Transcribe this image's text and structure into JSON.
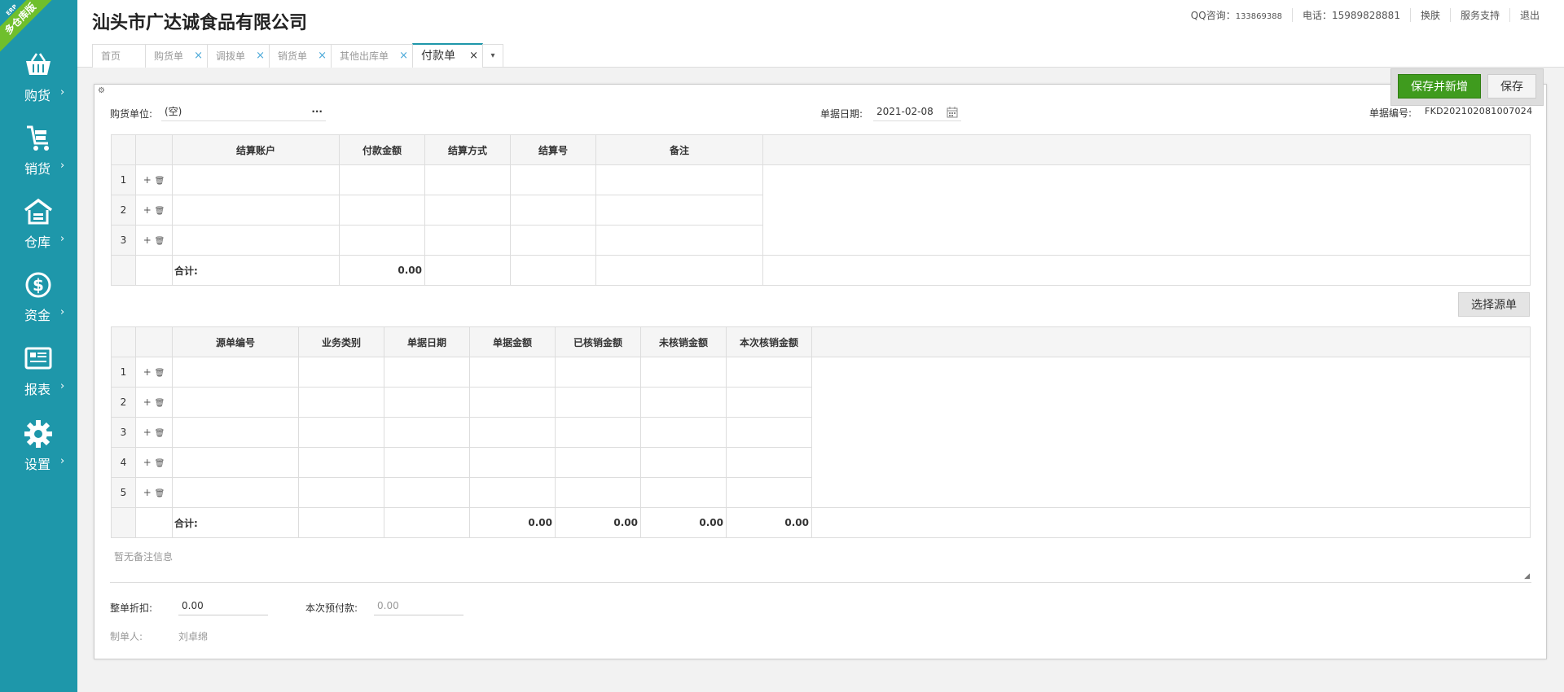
{
  "ribbon": {
    "text": "多仓库版",
    "sub": "ERP"
  },
  "sidebar": {
    "items": [
      {
        "label": "购货",
        "icon": "basket-icon"
      },
      {
        "label": "销货",
        "icon": "cart-icon"
      },
      {
        "label": "仓库",
        "icon": "warehouse-icon"
      },
      {
        "label": "资金",
        "icon": "dollar-icon"
      },
      {
        "label": "报表",
        "icon": "report-icon"
      },
      {
        "label": "设置",
        "icon": "gear-icon"
      }
    ],
    "arrow": "›"
  },
  "header": {
    "company": "汕头市广达诚食品有限公司",
    "qq_label": "QQ咨询：",
    "qq": "133869388",
    "phone": "电话：15989828881",
    "skin": "换肤",
    "support": "服务支持",
    "logout": "退出"
  },
  "tabs": [
    {
      "label": "首页",
      "closable": false
    },
    {
      "label": "购货单",
      "closable": true
    },
    {
      "label": "调拨单",
      "closable": true
    },
    {
      "label": "销货单",
      "closable": true
    },
    {
      "label": "其他出库单",
      "closable": true
    },
    {
      "label": "付款单",
      "closable": true,
      "active": true
    }
  ],
  "tab_close": "×",
  "tab_more": "▾",
  "actions": {
    "save_new": "保存并新增",
    "save": "保存"
  },
  "form": {
    "supplier_label": "购货单位:",
    "supplier_value": "(空)",
    "supplier_more": "···",
    "date_label": "单据日期:",
    "date_value": "2021-02-08",
    "no_label": "单据编号:",
    "no_value": "FKD202102081007024"
  },
  "grid1": {
    "headers": [
      "结算账户",
      "付款金额",
      "结算方式",
      "结算号",
      "备注"
    ],
    "rows": [
      "1",
      "2",
      "3"
    ],
    "total_label": "合计:",
    "total_amount": "0.00"
  },
  "select_source": "选择源单",
  "grid2": {
    "headers": [
      "源单编号",
      "业务类别",
      "单据日期",
      "单据金额",
      "已核销金额",
      "未核销金额",
      "本次核销金额"
    ],
    "rows": [
      "1",
      "2",
      "3",
      "4",
      "5"
    ],
    "total_label": "合计:",
    "totals": [
      "0.00",
      "0.00",
      "0.00",
      "0.00"
    ]
  },
  "ops": {
    "add": "+",
    "del": "🗑"
  },
  "remark_placeholder": "暂无备注信息",
  "discount_label": "整单折扣:",
  "discount_value": "0.00",
  "prepay_label": "本次预付款:",
  "prepay_value": "0.00",
  "maker_label": "制单人:",
  "maker_value": "刘卓绵",
  "colors": {
    "sidebar": "#1e97aa",
    "save_new": "#3f9b1e",
    "ribbon": "#6fbf2c"
  }
}
